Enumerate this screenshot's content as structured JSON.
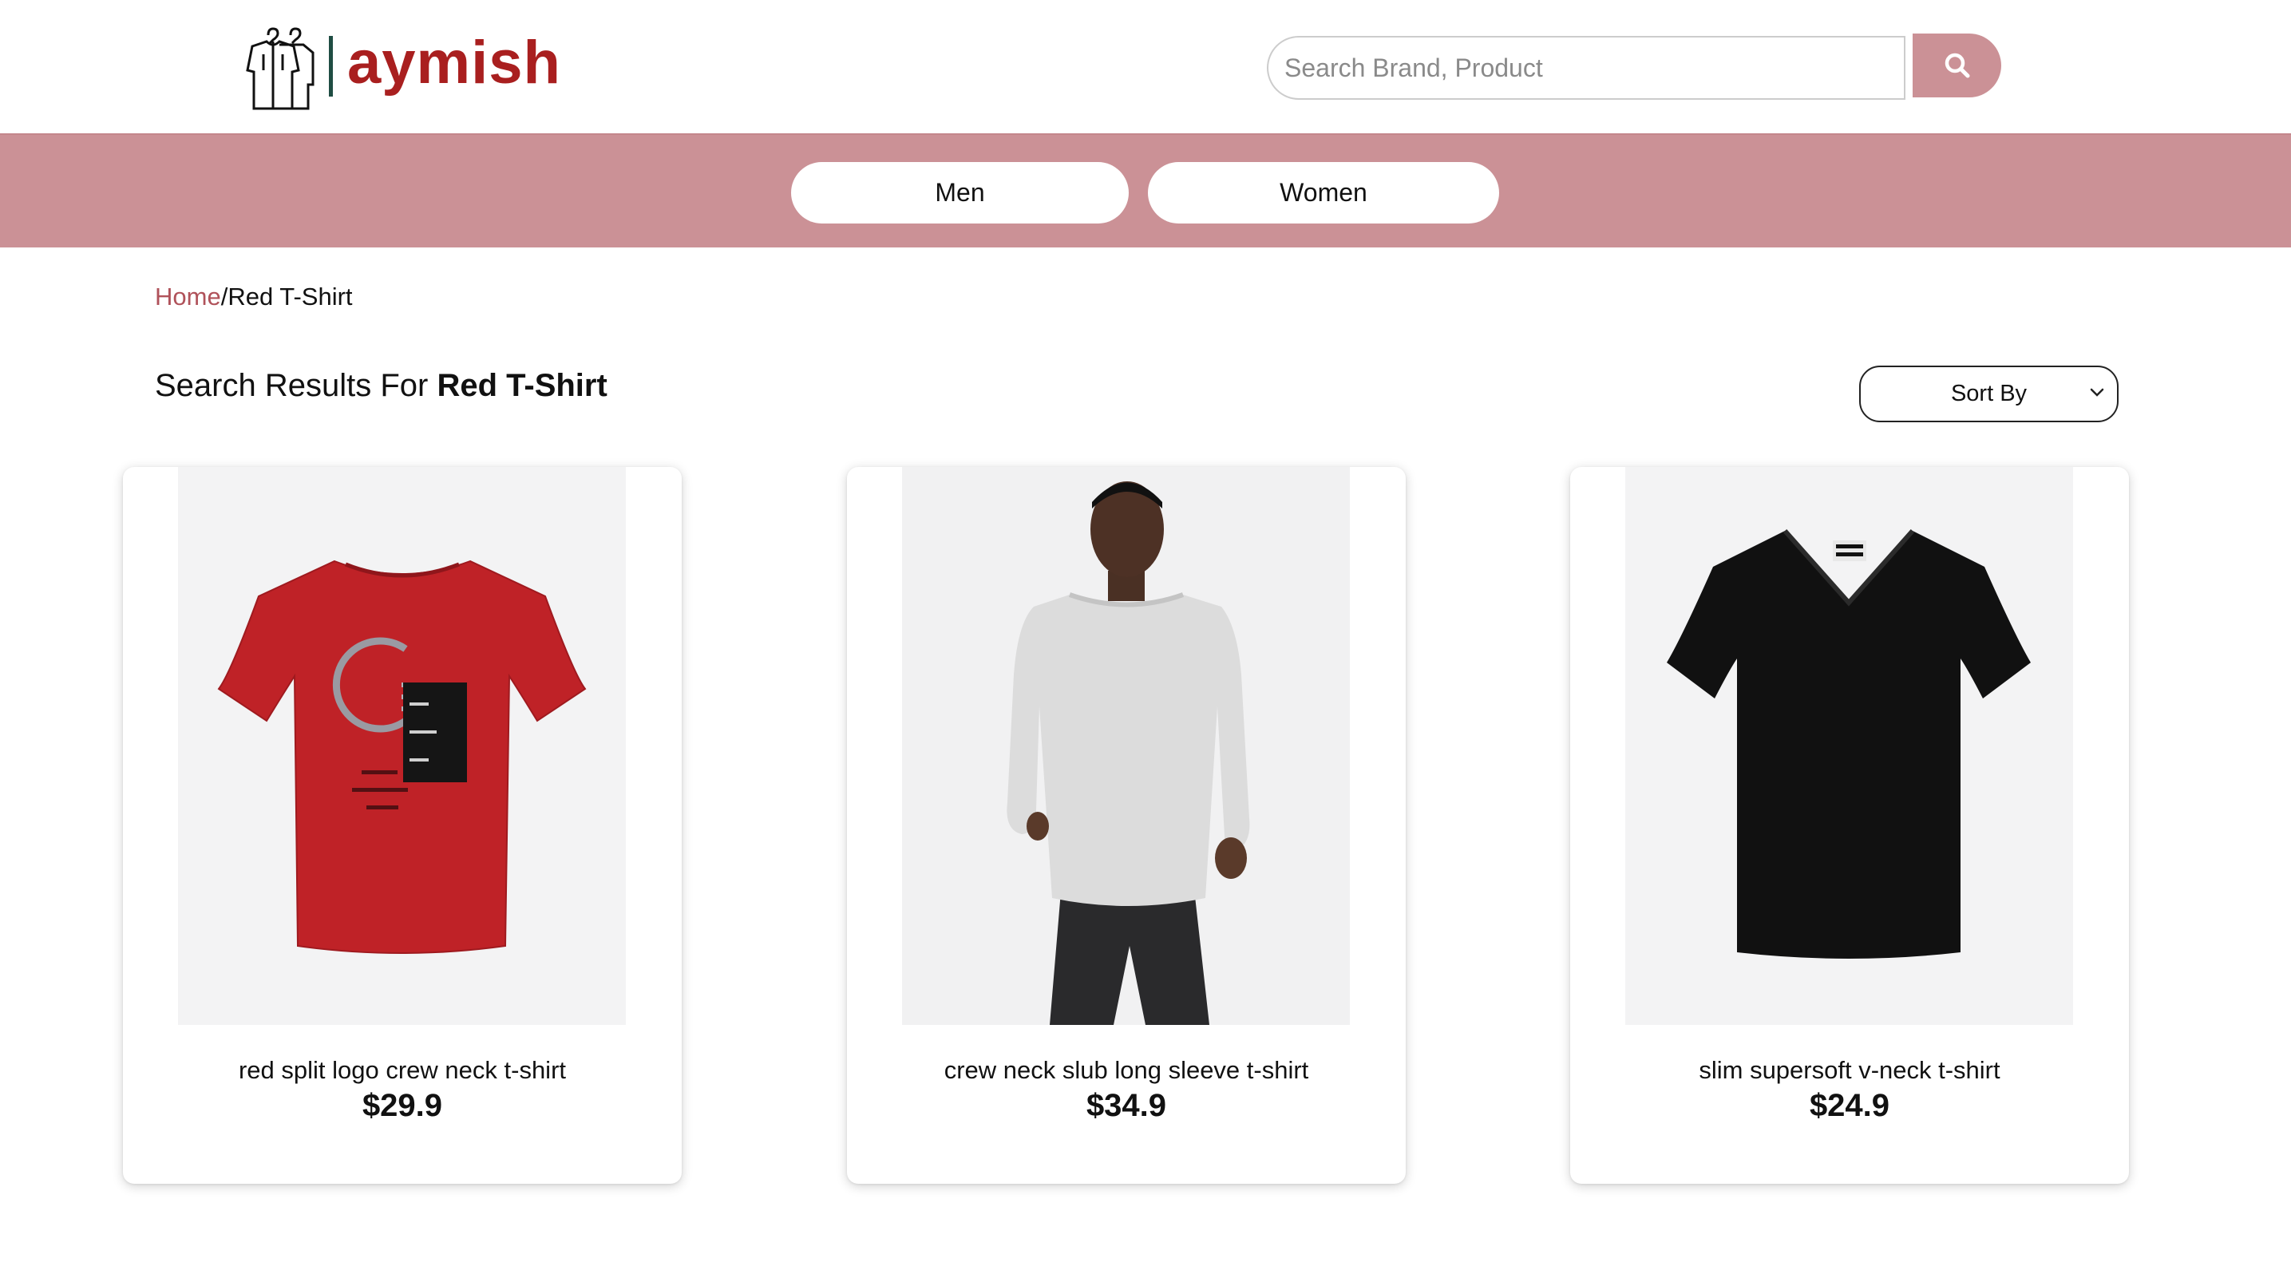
{
  "brand": {
    "name": "aymish",
    "logo_icon": "clothes-rack-icon",
    "primary_color": "#a91f1f",
    "accent_color": "#cb9196"
  },
  "search": {
    "placeholder": "Search Brand, Product",
    "value": "",
    "button_icon": "search-icon"
  },
  "nav": {
    "items": [
      {
        "label": "Men"
      },
      {
        "label": "Women"
      }
    ]
  },
  "breadcrumb": {
    "home": "Home",
    "separator": "/",
    "current": "Red T-Shirt"
  },
  "results": {
    "prefix": "Search Results For ",
    "query": "Red T-Shirt"
  },
  "sort": {
    "label": "Sort By",
    "icon": "chevron-down-icon"
  },
  "products": [
    {
      "title": "red split logo crew neck t-shirt",
      "price": "$29.9",
      "image": "red-tshirt-image"
    },
    {
      "title": "crew neck slub long sleeve t-shirt",
      "price": "$34.9",
      "image": "grey-long-sleeve-model-image"
    },
    {
      "title": "slim supersoft v-neck t-shirt",
      "price": "$24.9",
      "image": "black-vneck-tshirt-image"
    }
  ]
}
